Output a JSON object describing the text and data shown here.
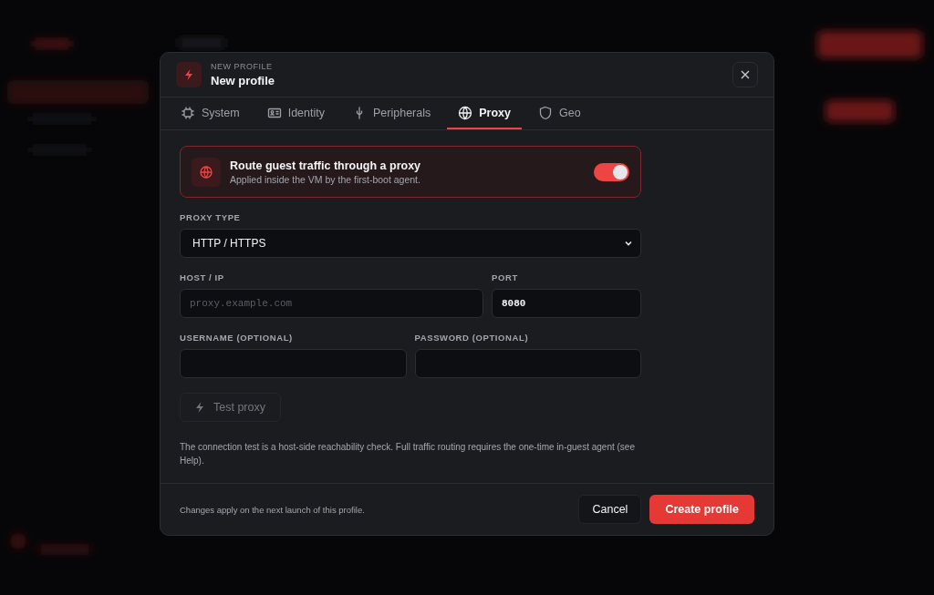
{
  "dialog": {
    "eyebrow": "NEW PROFILE",
    "title": "New profile"
  },
  "tabs": [
    {
      "label": "System",
      "selected": false
    },
    {
      "label": "Identity",
      "selected": false
    },
    {
      "label": "Peripherals",
      "selected": false
    },
    {
      "label": "Proxy",
      "selected": true
    },
    {
      "label": "Geo",
      "selected": false
    }
  ],
  "proxy_toggle": {
    "title": "Route guest traffic through a proxy",
    "subtitle": "Applied inside the VM by the first-boot agent.",
    "on": true
  },
  "proxy_type": {
    "label": "PROXY TYPE",
    "value": "HTTP / HTTPS"
  },
  "host": {
    "label": "HOST / IP",
    "placeholder": "proxy.example.com"
  },
  "port": {
    "label": "PORT",
    "value": "8080"
  },
  "username": {
    "label": "USERNAME (OPTIONAL)"
  },
  "password": {
    "label": "PASSWORD (OPTIONAL)"
  },
  "test_button": {
    "label": "Test proxy",
    "disabled": true
  },
  "note": "The connection test is a host-side reachability check. Full traffic routing requires the one-time in-guest agent (see Help).",
  "footer": {
    "note": "Changes apply on the next launch of this profile.",
    "cancel": "Cancel",
    "create": "Create profile"
  }
}
